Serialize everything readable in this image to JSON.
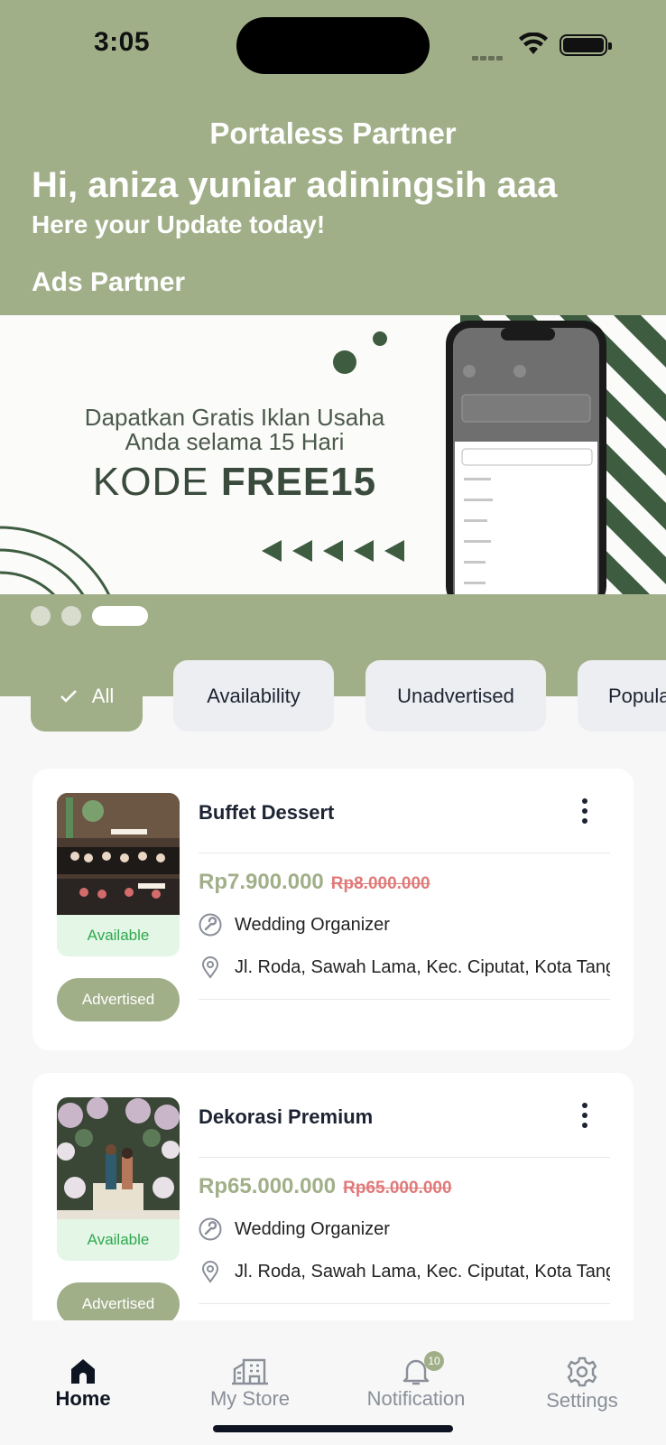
{
  "status_bar": {
    "time": "3:05"
  },
  "header": {
    "app_title": "Portaless Partner",
    "greeting": "Hi, aniza yuniar adiningsih aaa",
    "subgreeting": "Here your Update today!",
    "ads_title": "Ads Partner"
  },
  "banner": {
    "line1": "Dapatkan Gratis Iklan Usaha",
    "line2": "Anda selama 15 Hari",
    "code_prefix": "KODE ",
    "code": "FREE15"
  },
  "filters": {
    "items": [
      {
        "label": "All",
        "active": true
      },
      {
        "label": "Availability",
        "active": false
      },
      {
        "label": "Unadvertised",
        "active": false
      },
      {
        "label": "Popula",
        "active": false
      }
    ]
  },
  "listings": [
    {
      "title": "Buffet Dessert",
      "price": "Rp7.900.000",
      "old_price": "Rp8.000.000",
      "category": "Wedding Organizer",
      "address": "Jl. Roda, Sawah Lama, Kec. Ciputat, Kota Tangerang Selatan",
      "availability": "Available",
      "ad_status": "Advertised"
    },
    {
      "title": "Dekorasi Premium",
      "price": "Rp65.000.000",
      "old_price": "Rp65.000.000",
      "category": "Wedding Organizer",
      "address": "Jl. Roda, Sawah Lama, Kec. Ciputat, Kota Tangerang Selatan",
      "availability": "Available",
      "ad_status": "Advertised"
    }
  ],
  "bottom_nav": {
    "items": [
      {
        "label": "Home",
        "icon": "home-icon",
        "active": true
      },
      {
        "label": "My Store",
        "icon": "store-icon",
        "active": false
      },
      {
        "label": "Notification",
        "icon": "bell-icon",
        "active": false,
        "badge": "10"
      },
      {
        "label": "Settings",
        "icon": "gear-icon",
        "active": false
      }
    ]
  },
  "colors": {
    "accent": "#a1af89",
    "available_bg": "#e4f6e6",
    "available_text": "#2fa84f",
    "old_price": "#e07a7a",
    "banner_green": "#3d5c40"
  }
}
